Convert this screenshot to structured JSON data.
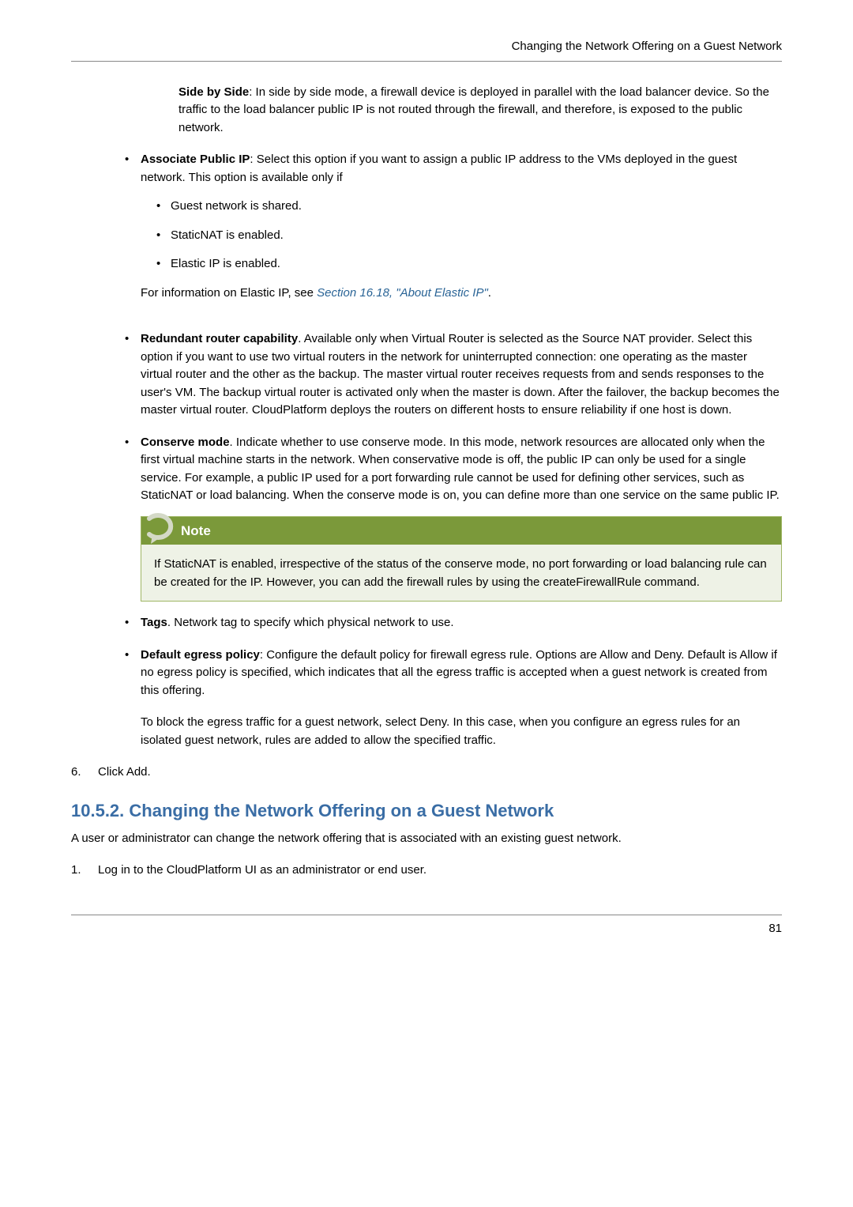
{
  "header": {
    "page_title": "Changing the Network Offering on a Guest Network"
  },
  "intro": {
    "side_by_side_label": "Side by Side",
    "side_by_side_text": ": In side by side mode, a firewall device is deployed in parallel with the load balancer device. So the traffic to the load balancer public IP is not routed through the firewall, and therefore, is exposed to the public network."
  },
  "associate": {
    "label": "Associate Public IP",
    "text": ": Select this option if you want to assign a public IP address to the VMs deployed in the guest network. This option is available only if",
    "items": {
      "a": "Guest network is shared.",
      "b": "StaticNAT is enabled.",
      "c": "Elastic IP is enabled."
    },
    "elastic_prefix": "For information on Elastic IP, see ",
    "elastic_link": "Section 16.18, \"About Elastic IP\"",
    "elastic_suffix": "."
  },
  "redundant": {
    "label": "Redundant router capability",
    "text": ". Available only when Virtual Router is selected as the Source NAT provider. Select this option if you want to use two virtual routers in the network for uninterrupted connection: one operating as the master virtual router and the other as the backup. The master virtual router receives requests from and sends responses to the user's VM. The backup virtual router is activated only when the master is down. After the failover, the backup becomes the master virtual router. CloudPlatform deploys the routers on different hosts to ensure reliability if one host is down."
  },
  "conserve": {
    "label": "Conserve mode",
    "text": ". Indicate whether to use conserve mode. In this mode, network resources are allocated only when the first virtual machine starts in the network. When conservative mode is off, the public IP can only be used for a single service. For example, a public IP used for a port forwarding rule cannot be used for defining other services, such as StaticNAT or load balancing. When the conserve mode is on, you can define more than one service on the same public IP."
  },
  "note": {
    "title": "Note",
    "body": "If StaticNAT is enabled, irrespective of the status of the conserve mode, no port forwarding or load balancing rule can be created for the IP. However, you can add the firewall rules by using the createFirewallRule command."
  },
  "tags": {
    "label": "Tags",
    "text": ". Network tag to specify which physical network to use."
  },
  "egress": {
    "label": "Default egress policy",
    "text": ": Configure the default policy for firewall egress rule. Options are Allow and Deny. Default is Allow if no egress policy is specified, which indicates that all the egress traffic is accepted when a guest network is created from this offering.",
    "text2": "To block the egress traffic for a guest network, select Deny. In this case, when you configure an egress rules for an isolated guest network, rules are added to allow the specified traffic."
  },
  "step6": {
    "num": "6.",
    "text": "Click Add."
  },
  "section": {
    "title": "10.5.2. Changing the Network Offering on a Guest Network",
    "intro": "A user or administrator can change the network offering that is associated with an existing guest network."
  },
  "step1": {
    "num": "1.",
    "text": "Log in to the CloudPlatform UI as an administrator or end user."
  },
  "footer": {
    "page": "81"
  }
}
